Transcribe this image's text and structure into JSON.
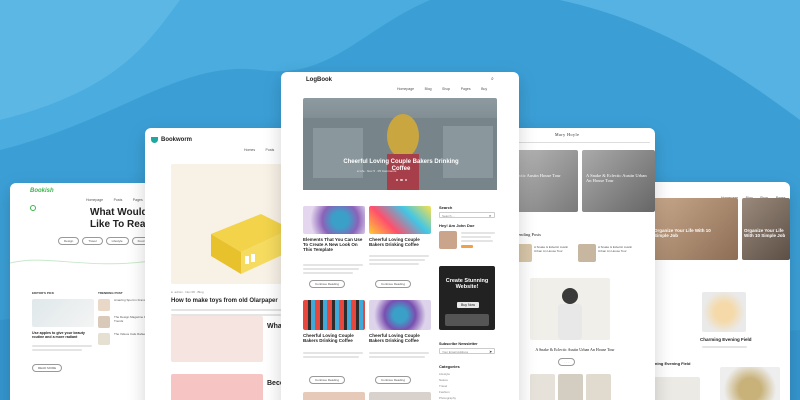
{
  "theme_a": {
    "logo": "Bookish",
    "nav": [
      "Homepage",
      "Posts",
      "Pages",
      "Shop"
    ],
    "hero_heading": "What Would You Like To Read",
    "tags": [
      "Design",
      "Travel",
      "Lifestyle",
      "Food",
      "Fashion"
    ],
    "editors_pick_label": "EDITOR'S PICK",
    "trending_label": "TRENDING POST",
    "editors_post_title": "Use apples to give your beauty routine and a more radiant",
    "trending_items": [
      "Amazing Sport in France Traveling",
      "The Design Magazine Fashion Trends",
      "The Videos Cafe Rafaella"
    ],
    "read_more": "READ MORE"
  },
  "theme_b": {
    "logo": "Bookworm",
    "nav": [
      "Homes",
      "Posts",
      "Pages"
    ],
    "post1_title": "How to make toys from old Olarpaper",
    "post2_title": "Wha Photo",
    "post3_title": "Beco the H",
    "read_more": "READ MORE"
  },
  "theme_c": {
    "logo": "LogBook",
    "nav": [
      "Homepage",
      "Blog",
      "Shop",
      "Pages",
      "Buy"
    ],
    "hero_title": "Cheerful Loving Couple Bakers Drinking Coffee",
    "posts": [
      {
        "title": "Elements That You Can Use To Create A New Look On This Template"
      },
      {
        "title": "Cheerful Loving Couple Bakers Drinking Coffee"
      },
      {
        "title": "Cheerful Loving Couple Bakers Drinking Coffee"
      },
      {
        "title": "Cheerful Loving Couple Bakers Drinking Coffee"
      }
    ],
    "continue_label": "Continue Reading",
    "search_label": "Search",
    "search_placeholder": "Search ...",
    "author_label": "Hey! Am John Doe",
    "promo_title": "Create Stunning Website!",
    "promo_button": "Buy Now",
    "subscribe_label": "Subscribe Newsletter",
    "subscribe_placeholder": "Your Email Address",
    "categories_label": "Categories",
    "categories": [
      "Lifestyle",
      "Nature",
      "Travel",
      "Fashion",
      "Photography"
    ]
  },
  "theme_d": {
    "logo": "Mary Hoyle",
    "hero_title": "A Snake & Eclectic Austin Urban An House Tour",
    "hero_title_left": "clectic Austin House Tour",
    "trending_label": "Trending Posts",
    "trending_posts": [
      "A Snake & Eclectic Austin Urban An House Tour",
      "A Snake & Eclectic Austin Urban An House Tour"
    ],
    "bottom_post": "A Snake & Eclectic Austin Urban An House Tour"
  },
  "theme_e": {
    "nav": [
      "Homepage",
      "Blog",
      "Shop",
      "Pages"
    ],
    "slide_title": "Organize Your Life With 10 Simple Job",
    "slide_title2": "Organize Your Life With 10 Simple Job",
    "post_title": "Charming Evening Field",
    "post_title_left": "arming Evening Field"
  },
  "colors": {
    "background": "#3fa3d8",
    "accent_green": "#39b54a",
    "accent_teal": "#1fa8a0",
    "accent_orange": "#f0a04b"
  }
}
